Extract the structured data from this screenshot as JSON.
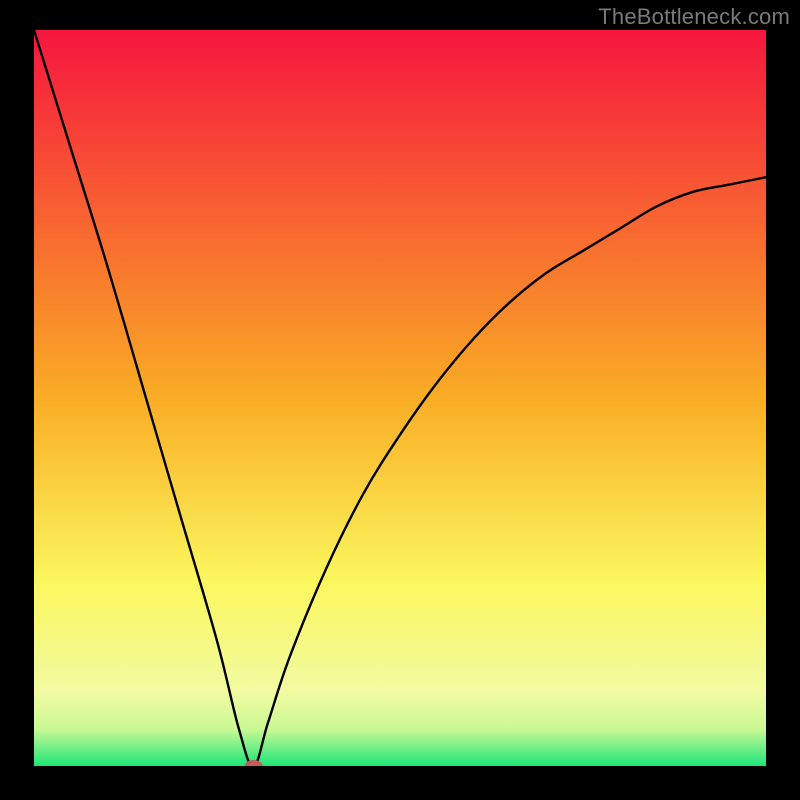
{
  "watermark": "TheBottleneck.com",
  "chart_data": {
    "type": "line",
    "title": "",
    "xlabel": "",
    "ylabel": "",
    "xlim": [
      0,
      100
    ],
    "ylim": [
      0,
      100
    ],
    "grid": false,
    "legend": false,
    "background_gradient": {
      "stops": [
        {
          "offset": 0.0,
          "color": "#f6163e"
        },
        {
          "offset": 0.5,
          "color": "#f9ad25"
        },
        {
          "offset": 0.75,
          "color": "#fbf75e"
        },
        {
          "offset": 0.9,
          "color": "#f2fba2"
        },
        {
          "offset": 0.95,
          "color": "#c9f994"
        },
        {
          "offset": 1.0,
          "color": "#1de579"
        }
      ]
    },
    "curve_comment": "Bottleneck magnitude curve; minimum (0%) at x≈30. Rises steeply toward 100% as x→0 and approaches ~80% as x→100.",
    "series": [
      {
        "name": "bottleneck-curve",
        "x": [
          0,
          5,
          10,
          15,
          20,
          25,
          28,
          30,
          32,
          35,
          40,
          45,
          50,
          55,
          60,
          65,
          70,
          75,
          80,
          85,
          90,
          95,
          100
        ],
        "y": [
          100,
          84,
          68,
          51,
          34,
          17,
          5,
          0,
          6,
          15,
          27,
          37,
          45,
          52,
          58,
          63,
          67,
          70,
          73,
          76,
          78,
          79,
          80
        ]
      }
    ],
    "marker": {
      "x": 30,
      "y": 0,
      "color": "#c55a5a"
    }
  }
}
